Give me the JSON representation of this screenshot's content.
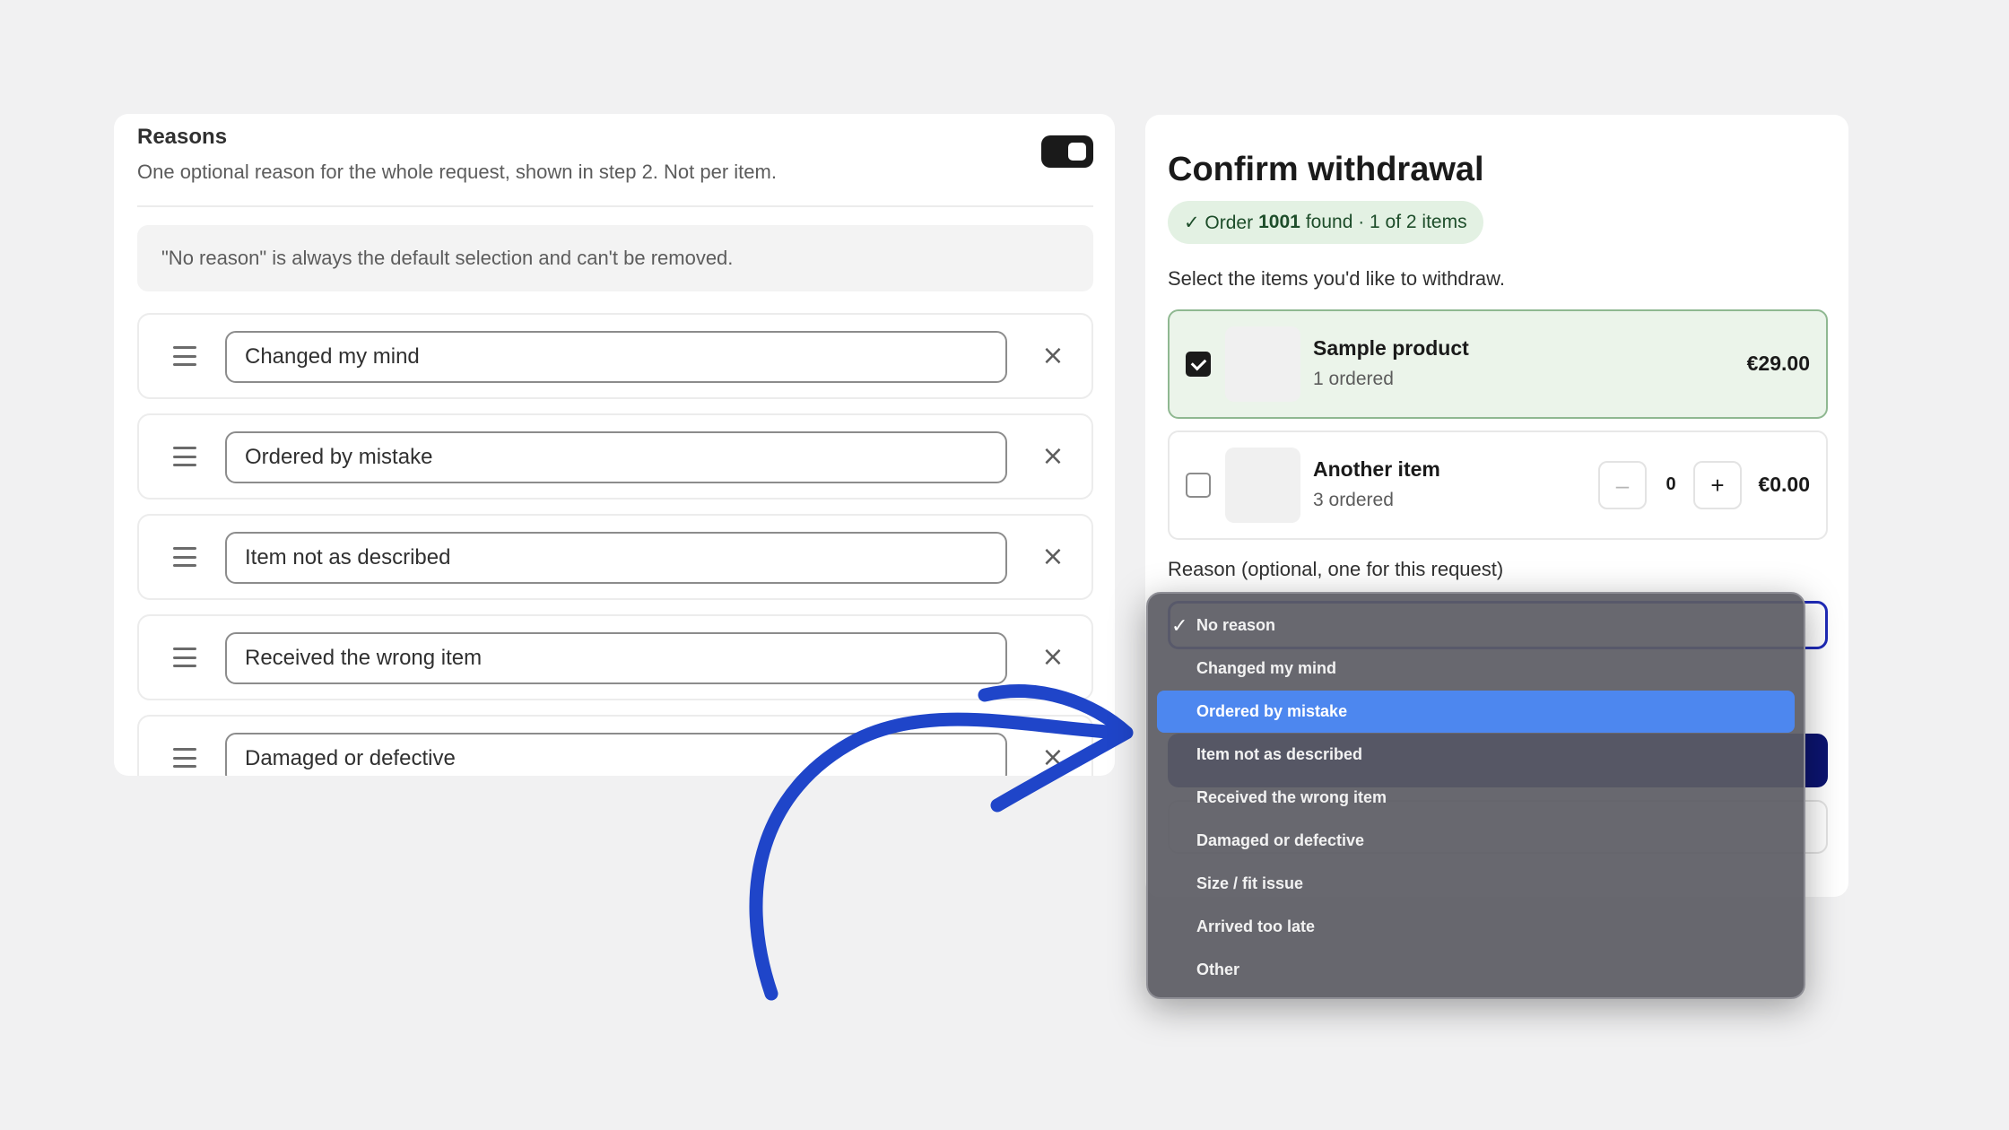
{
  "reasons_panel": {
    "title": "Reasons",
    "subtitle": "One optional reason for the whole request, shown in step 2. Not per item.",
    "toggle_on": true,
    "info": "\"No reason\" is always the default selection and can't be removed.",
    "items": [
      {
        "value": "Changed my mind"
      },
      {
        "value": "Ordered by mistake"
      },
      {
        "value": "Item not as described"
      },
      {
        "value": "Received the wrong item"
      },
      {
        "value": "Damaged or defective"
      }
    ],
    "remove_glyph": "×"
  },
  "withdrawal": {
    "title": "Confirm withdrawal",
    "badge": {
      "prefix": "✓ Order",
      "order_number": "1001",
      "suffix": "found · 1 of 2 items"
    },
    "instructions": "Select the items you'd like to withdraw.",
    "items": [
      {
        "name": "Sample product",
        "qty_label": "1 ordered",
        "price": "€29.00",
        "checked": true
      },
      {
        "name": "Another item",
        "qty_label": "3 ordered",
        "price": "€0.00",
        "checked": false,
        "quantity": "0",
        "minus": "–",
        "plus": "+"
      }
    ],
    "reason_label": "Reason (optional, one for this request)"
  },
  "dropdown": {
    "selected": "No reason",
    "highlighted": "Ordered by mistake",
    "options": [
      "No reason",
      "Changed my mind",
      "Ordered by mistake",
      "Item not as described",
      "Received the wrong item",
      "Damaged or defective",
      "Size / fit issue",
      "Arrived too late",
      "Other"
    ]
  },
  "colors": {
    "accent_blue": "#1f45c9",
    "highlight": "#4d87ef",
    "badge_bg": "#e3f1e3",
    "selected_card_bg": "#ebf4ea",
    "primary_button": "#0c1470"
  }
}
